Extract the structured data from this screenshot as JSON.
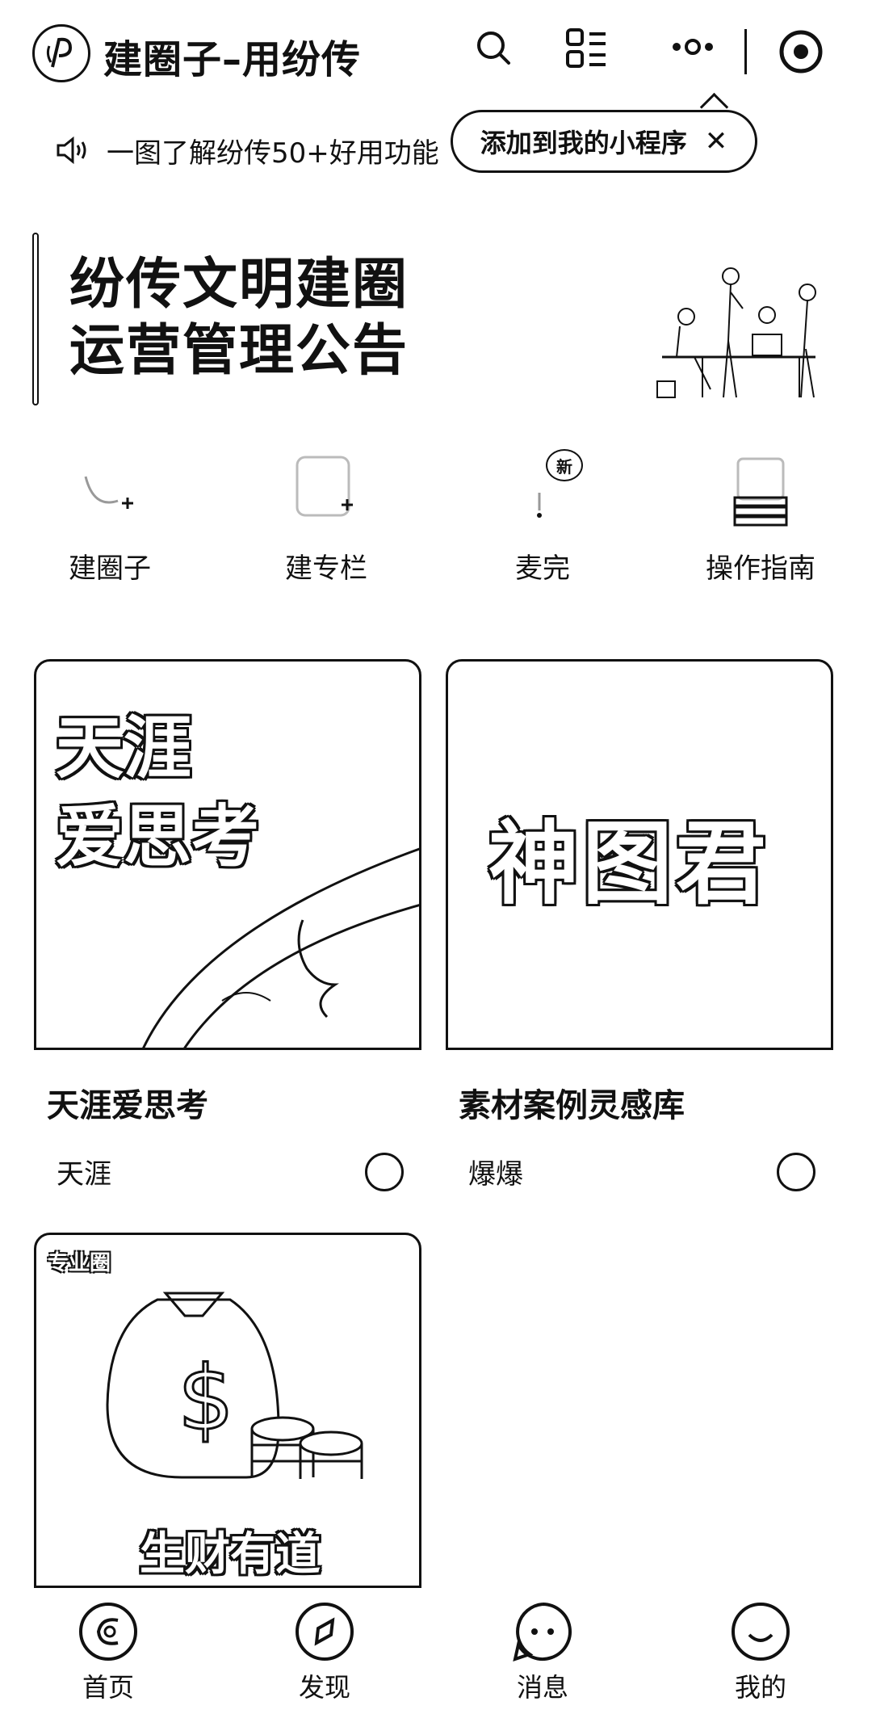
{
  "header": {
    "title": "建圈子–用纷传",
    "icons": [
      "app-logo-icon",
      "search-icon",
      "grid-list-icon",
      "more-icon",
      "target-icon"
    ]
  },
  "announcement": {
    "text": "一图了解纷传50+好用功能"
  },
  "tooltip": {
    "label": "添加到我的小程序",
    "close": "✕"
  },
  "banner": {
    "title": "纷传文明建圈\n运营管理公告"
  },
  "quick_actions": [
    {
      "label": "建圈子",
      "icon": "create-circle-icon"
    },
    {
      "label": "建专栏",
      "icon": "create-column-icon"
    },
    {
      "label": "麦完",
      "icon": "mic-icon",
      "badge": "新"
    },
    {
      "label": "操作指南",
      "icon": "guide-book-icon"
    }
  ],
  "cards": [
    {
      "cover_line1": "天涯",
      "cover_line2": "爱思考",
      "title": "天涯爱思考",
      "author": "天涯"
    },
    {
      "cover_text": "神图君",
      "title": "素材案例灵感库",
      "author": "爆爆"
    },
    {
      "badge": "专业圈",
      "cover_text": "生财有道"
    }
  ],
  "tabs": [
    {
      "label": "首页",
      "icon": "home-icon"
    },
    {
      "label": "发现",
      "icon": "compass-icon"
    },
    {
      "label": "消息",
      "icon": "message-icon"
    },
    {
      "label": "我的",
      "icon": "profile-icon"
    }
  ],
  "colors": {
    "ink": "#111111",
    "background": "#ffffff"
  }
}
